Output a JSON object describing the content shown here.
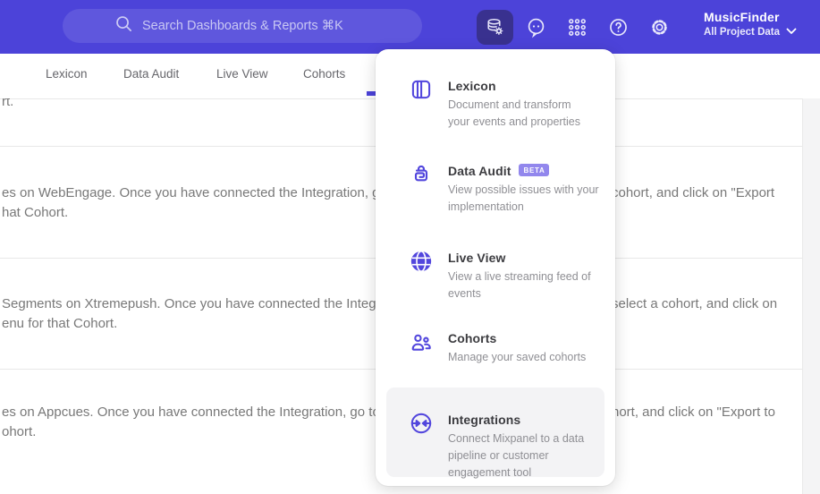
{
  "header": {
    "search": {
      "placeholder": "Search Dashboards & Reports ⌘K"
    },
    "account": {
      "name": "MusicFinder",
      "project": "All Project Data"
    }
  },
  "nav": {
    "tabs": [
      {
        "label": "Lexicon"
      },
      {
        "label": "Data Audit"
      },
      {
        "label": "Live View"
      },
      {
        "label": "Cohorts"
      }
    ]
  },
  "menu": {
    "items": [
      {
        "title": "Lexicon",
        "description": "Document and transform\nyour events and properties"
      },
      {
        "title": "Data Audit",
        "badge": "BETA",
        "description": "View possible issues with your\nimplementation"
      },
      {
        "title": "Live View",
        "description": "View a live streaming feed of\nevents"
      },
      {
        "title": "Cohorts",
        "description": "Manage your saved cohorts"
      },
      {
        "title": "Integrations",
        "description": "Connect Mixpanel to a data\npipeline or customer\nengagement tool",
        "highlighted": true
      }
    ]
  },
  "content": {
    "rows": [
      {
        "fragment": "rt."
      },
      {
        "left": "es on WebEngage. Once you have connected the Integration, go to the",
        "right": "cohort, and click on \"Export",
        "line2": "hat Cohort."
      },
      {
        "left": "Segments on Xtremepush. Once you have connected the Integration,",
        "right": "select a cohort, and click on",
        "line2": "enu for that Cohort."
      },
      {
        "left": "es on Appcues. Once you have connected the Integration, go to the M",
        "right": "hort, and click on \"Export to",
        "line2": "ohort."
      }
    ]
  },
  "colors": {
    "header_bg": "#4c43d9",
    "accent": "#5246dd",
    "active_button_bg": "#39318f",
    "badge_bg": "#9287ed",
    "hover_item_bg": "#f3f3f5",
    "body_text": "#787878",
    "divider": "#e8e8e8"
  }
}
